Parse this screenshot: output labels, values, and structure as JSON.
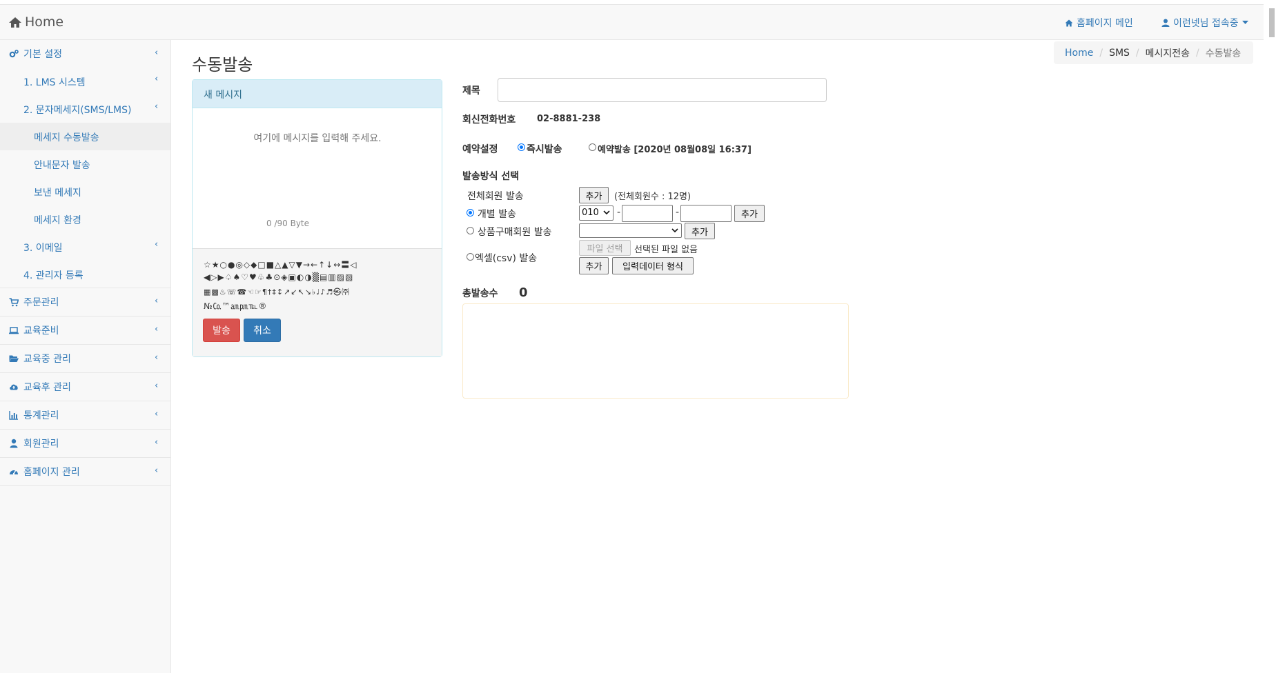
{
  "navbar": {
    "brand": "Home",
    "homepage_link": "홈페이지 메인",
    "user_menu": "이런넷님 접속중"
  },
  "sidebar": {
    "basic_settings": "기본 설정",
    "sub_lms": "1. LMS 시스템",
    "sub_sms": "2. 문자메세지(SMS/LMS)",
    "sub_sms_manual": "메세지 수동발송",
    "sub_sms_notice": "안내문자 발송",
    "sub_sms_sent": "보낸 메세지",
    "sub_sms_env": "메세지 환경",
    "sub_email": "3. 이메일",
    "sub_admin": "4. 관리자 등록",
    "order": "주문관리",
    "edu_prep": "교육준비",
    "edu_mid": "교육중 관리",
    "edu_after": "교육후 관리",
    "stats": "통계관리",
    "members": "회원관리",
    "homepage": "홈페이지 관리"
  },
  "page": {
    "title": "수동발송"
  },
  "breadcrumb": [
    "Home",
    "SMS",
    "메시지전송",
    "수동발송"
  ],
  "panel": {
    "header": "새 메시지",
    "placeholder": "여기에 메시지를 입력해 주세요.",
    "byte_count": "0",
    "byte_limit": "/90 Byte",
    "symbols_line1": "☆★○●◎◇◆□■△▲▽▼→←↑↓↔〓◁",
    "symbols_line2": "◀▷▶♤♠♡♥♧♣⊙◈▣◐◑▒▤▥▨▧",
    "symbols_line3": "▦▩♨☏☎☜☞¶†‡↕↗↙↖↘♭♩♪♬㉿㈜",
    "symbols_line4": "№㏇™㏂㏘℡®",
    "send_button": "발송",
    "cancel_button": "취소"
  },
  "form": {
    "subject_label": "제목",
    "subject_value": "",
    "reply_label": "회신전화번호",
    "reply_number": "02-8881-238",
    "schedule_label": "예약설정",
    "schedule_now": "즉시발송",
    "schedule_later": "예약발송 [2020년 08월08일 16:37]",
    "method_label": "발송방식 선택",
    "all_members_label": "전체회원 발송",
    "add_label": "추가",
    "all_members_count": "(전체회원수 : 12명)",
    "individual_label": "개별 발송",
    "phone_prefix": "010",
    "product_buyers_label": "상품구매회원 발송",
    "product_select_value": "",
    "excel_label": "엑셀(csv) 발송",
    "file_button": "파일 선택",
    "file_status": "선택된 파일 없음",
    "input_format_button": "입력데이터 형식",
    "total_label": "총발송수",
    "total_value": "0"
  }
}
